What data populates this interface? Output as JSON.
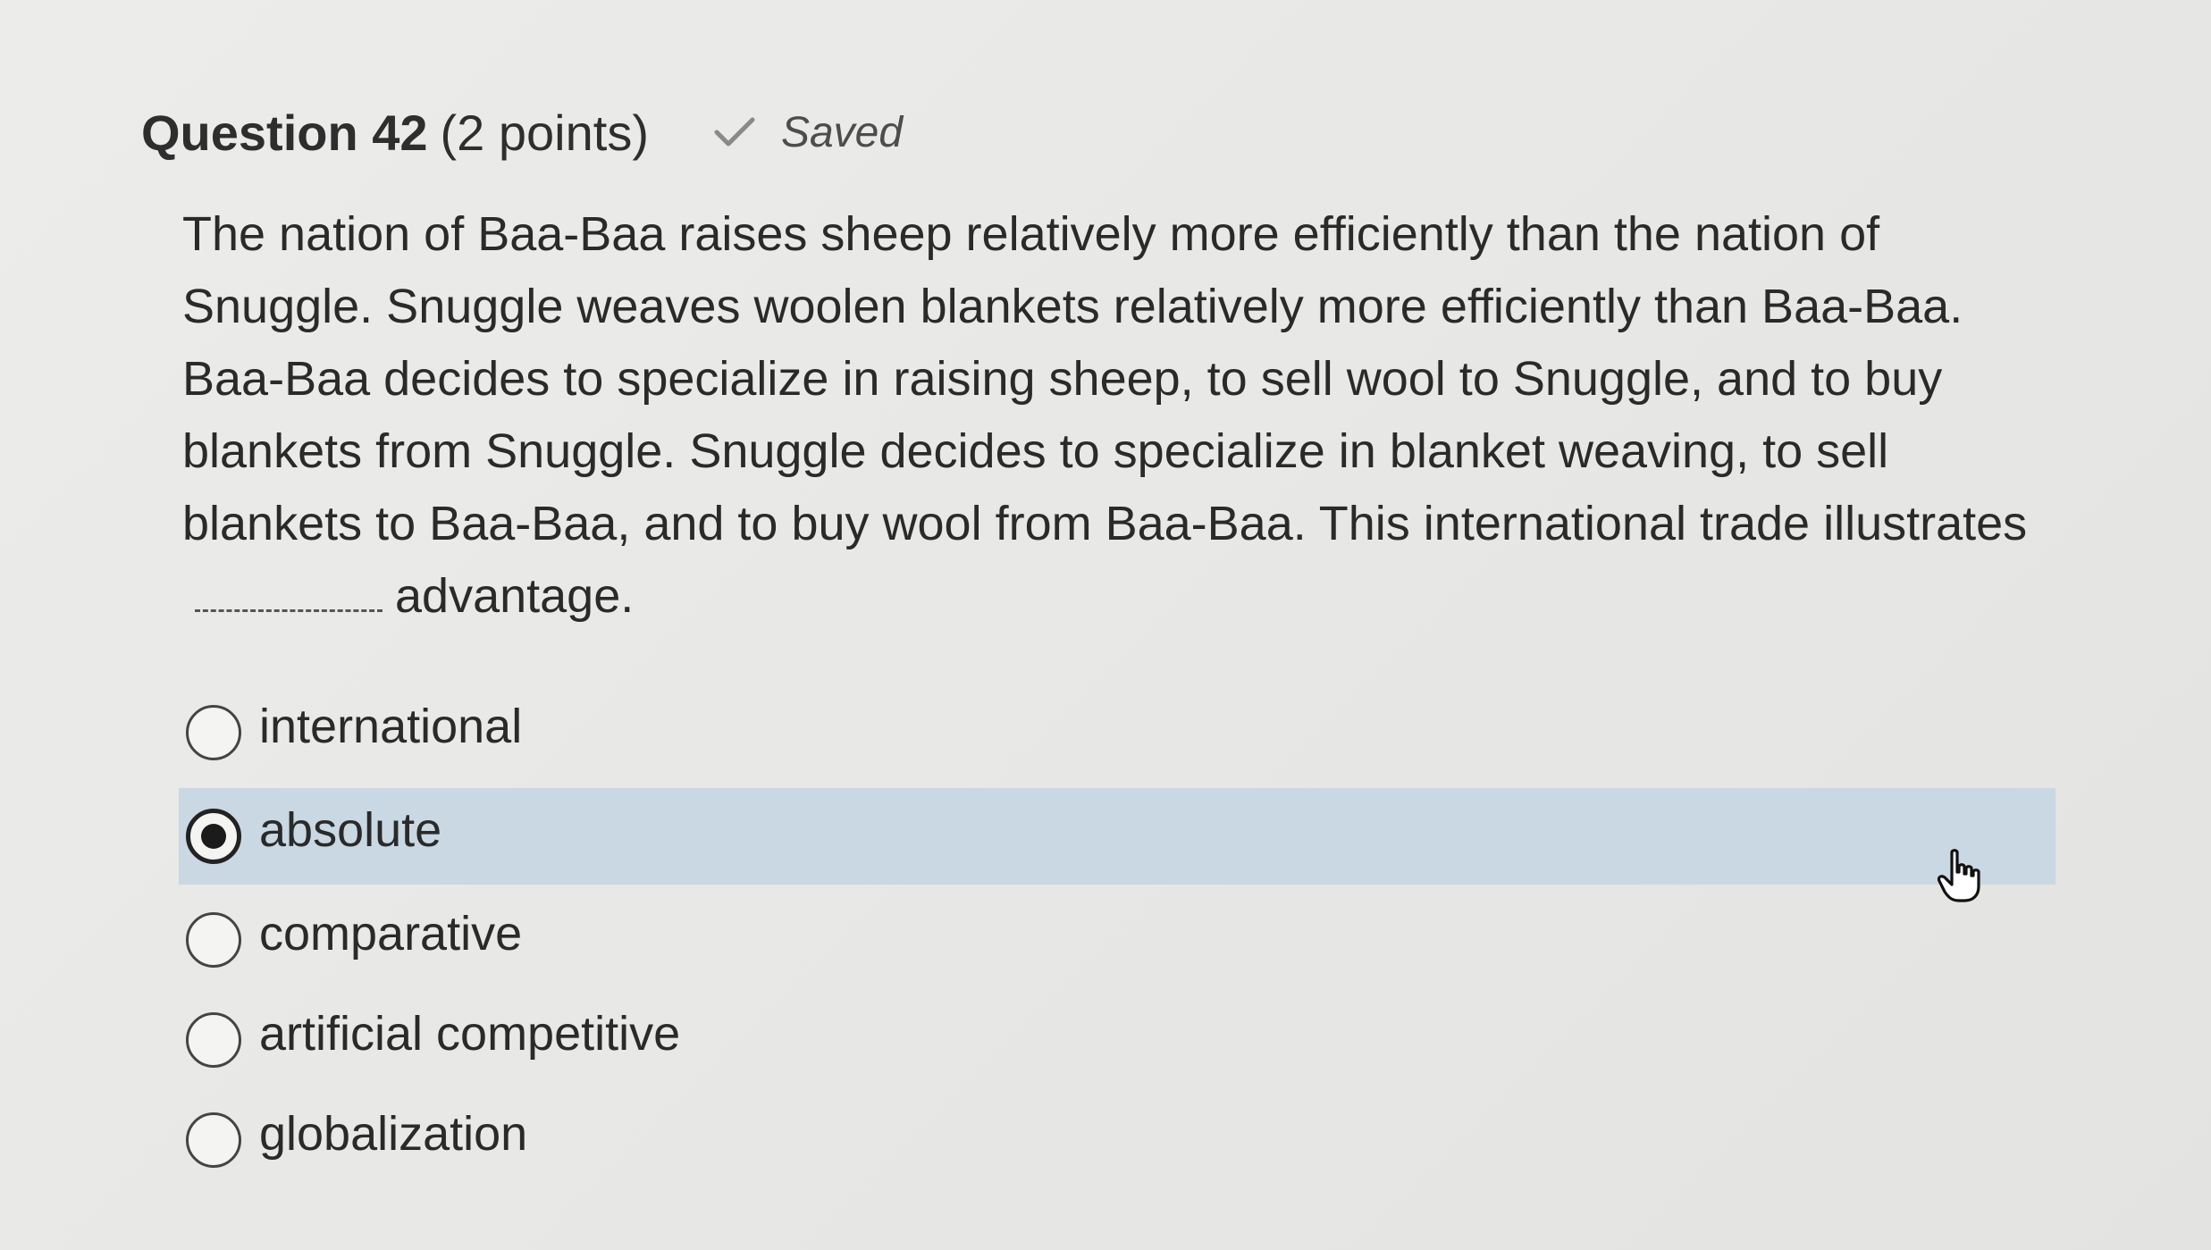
{
  "question": {
    "title": "Question 42",
    "points": "(2 points)",
    "status": "Saved",
    "text_before_blank": "The nation of Baa-Baa raises sheep relatively more efficiently than the nation of Snuggle. Snuggle weaves woolen blankets relatively more efficiently than Baa-Baa. Baa-Baa decides to specialize in raising sheep, to sell wool to Snuggle, and to buy blankets from Snuggle. Snuggle decides to specialize in blanket weaving, to sell blankets to Baa-Baa, and to buy wool from Baa-Baa. This international trade illustrates",
    "text_after_blank": "advantage."
  },
  "options": [
    {
      "label": "international",
      "selected": false
    },
    {
      "label": "absolute",
      "selected": true
    },
    {
      "label": "comparative",
      "selected": false
    },
    {
      "label": "artificial competitive",
      "selected": false
    },
    {
      "label": "globalization",
      "selected": false
    }
  ],
  "colors": {
    "selected_row": "#c9d8e3",
    "text": "#2a2a2a",
    "background": "#e9e9e7"
  },
  "icons": {
    "status": "check-icon",
    "cursor": "hand-pointer-icon"
  }
}
